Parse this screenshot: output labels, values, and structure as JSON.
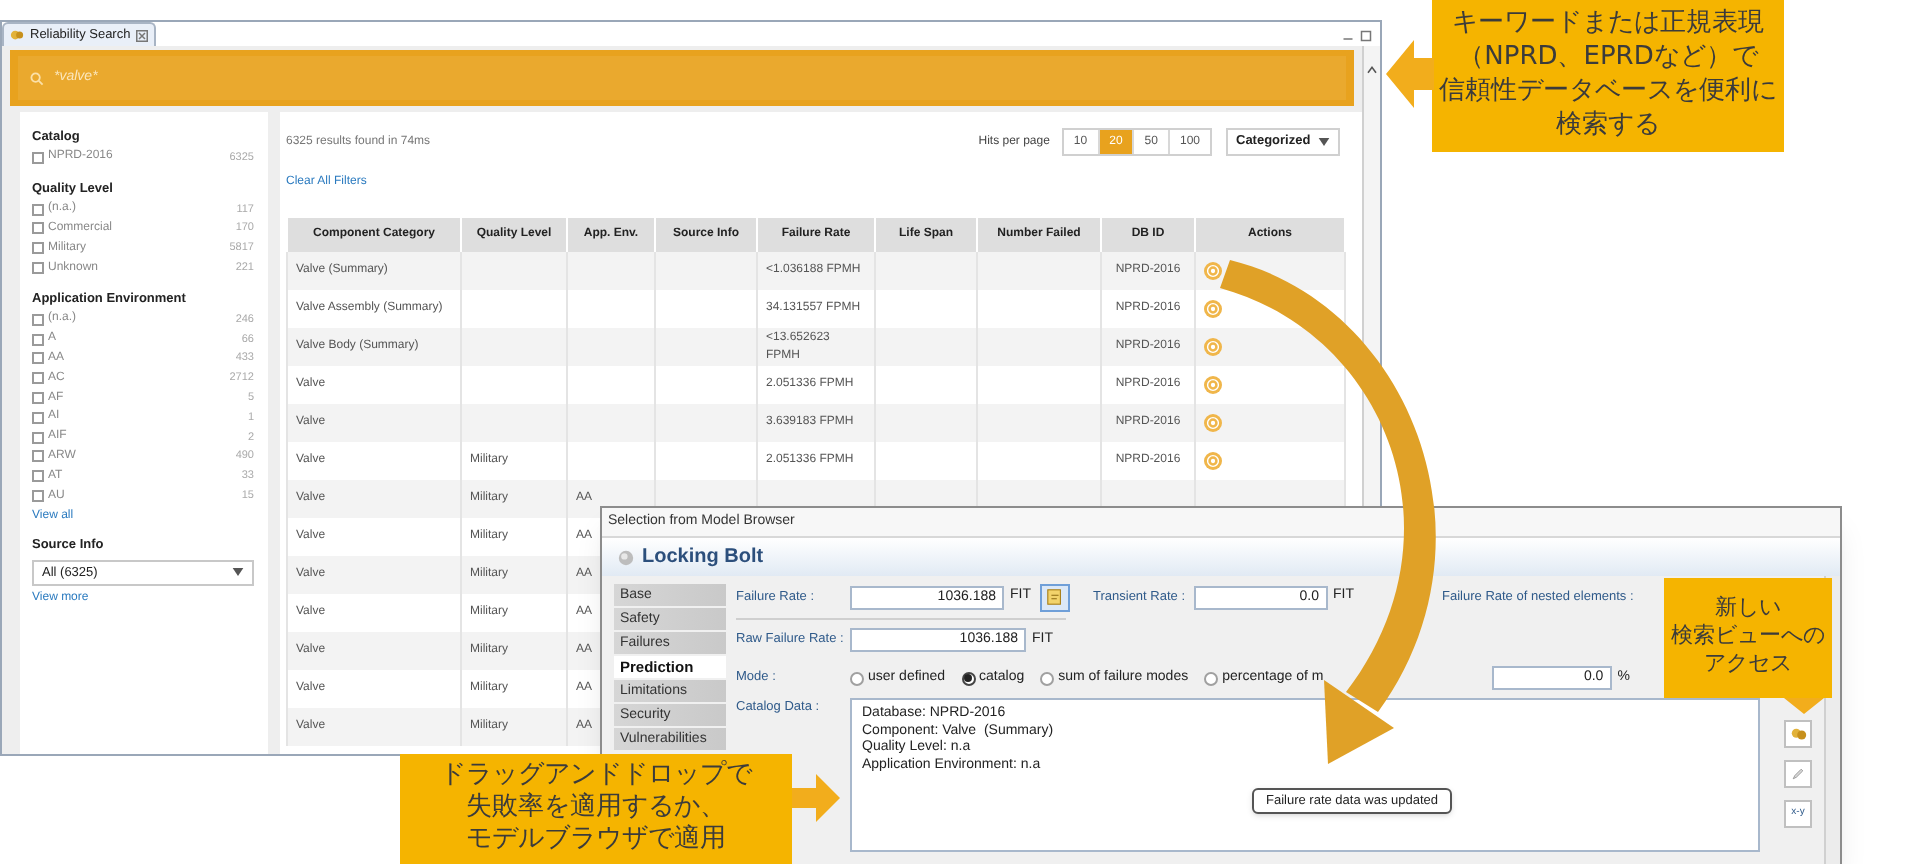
{
  "view_tab": {
    "title": "Reliability Search"
  },
  "search": {
    "value": "*valve*"
  },
  "filters": [
    {
      "title": "Catalog",
      "options": [
        {
          "label": "NPRD-2016",
          "count": "6325",
          "checked": false
        }
      ]
    },
    {
      "title": "Quality Level",
      "options": [
        {
          "label": "(n.a.)",
          "count": "117",
          "checked": false
        },
        {
          "label": "Commercial",
          "count": "170",
          "checked": false
        },
        {
          "label": "Military",
          "count": "5817",
          "checked": false
        },
        {
          "label": "Unknown",
          "count": "221",
          "checked": false
        }
      ]
    },
    {
      "title": "Application Environment",
      "link": "View all",
      "options": [
        {
          "label": "(n.a.)",
          "count": "246",
          "checked": false
        },
        {
          "label": "A",
          "count": "66",
          "checked": false
        },
        {
          "label": "AA",
          "count": "433",
          "checked": false
        },
        {
          "label": "AC",
          "count": "2712",
          "checked": false
        },
        {
          "label": "AF",
          "count": "5",
          "checked": false
        },
        {
          "label": "AI",
          "count": "1",
          "checked": false
        },
        {
          "label": "AIF",
          "count": "2",
          "checked": false
        },
        {
          "label": "ARW",
          "count": "490",
          "checked": false
        },
        {
          "label": "AT",
          "count": "33",
          "checked": false
        },
        {
          "label": "AU",
          "count": "15",
          "checked": false
        }
      ]
    }
  ],
  "source_info": {
    "title": "Source Info",
    "value": "All (6325)",
    "link": "View more"
  },
  "results": {
    "summary": "6325 results found in 74ms",
    "clear_link": "Clear All Filters",
    "hits_label": "Hits per page",
    "hits": [
      {
        "label": "10",
        "selected": false
      },
      {
        "label": "20",
        "selected": true
      },
      {
        "label": "50",
        "selected": false
      },
      {
        "label": "100",
        "selected": false
      }
    ],
    "view_mode": "Categorized"
  },
  "table": {
    "columns": [
      "Component Category",
      "Quality Level",
      "App. Env.",
      "Source Info",
      "Failure Rate",
      "Life Span",
      "Number Failed",
      "DB ID",
      "Actions"
    ],
    "rows": [
      {
        "category": "Valve (Summary)",
        "failure_rate": "<1.036188 FPMH",
        "db_id": "NPRD-2016",
        "action": true
      },
      {
        "category": "Valve Assembly (Summary)",
        "failure_rate": "34.131557 FPMH",
        "db_id": "NPRD-2016",
        "action": true
      },
      {
        "category": "Valve Body (Summary)",
        "failure_rate": "<13.652623 FPMH",
        "db_id": "NPRD-2016",
        "action": true
      },
      {
        "category": "Valve",
        "failure_rate": "2.051336 FPMH",
        "db_id": "NPRD-2016",
        "action": true
      },
      {
        "category": "Valve",
        "failure_rate": "3.639183 FPMH",
        "db_id": "NPRD-2016",
        "action": true
      },
      {
        "category": "Valve",
        "quality": "Military",
        "failure_rate": "2.051336 FPMH",
        "db_id": "NPRD-2016",
        "action": true
      },
      {
        "category": "Valve",
        "quality": "Military",
        "env": "AA"
      },
      {
        "category": "Valve",
        "quality": "Military",
        "env": "AA"
      },
      {
        "category": "Valve",
        "quality": "Military",
        "env": "AA"
      },
      {
        "category": "Valve",
        "quality": "Military",
        "env": "AA"
      },
      {
        "category": "Valve",
        "quality": "Military",
        "env": "AA"
      },
      {
        "category": "Valve",
        "quality": "Military",
        "env": "AA"
      },
      {
        "category": "Valve",
        "quality": "Military",
        "env": "AA"
      }
    ]
  },
  "dialog": {
    "title": "Selection from Model Browser",
    "header": "Locking Bolt",
    "tabs": [
      {
        "label": "Base",
        "selected": false
      },
      {
        "label": "Safety",
        "selected": false
      },
      {
        "label": "Failures",
        "selected": false
      },
      {
        "label": "Prediction",
        "selected": true
      },
      {
        "label": "Limitations",
        "selected": false
      },
      {
        "label": "Security",
        "selected": false
      },
      {
        "label": "Vulnerabilities",
        "selected": false
      }
    ],
    "failure_rate": {
      "label": "Failure Rate :",
      "value": "1036.188",
      "unit": "FIT"
    },
    "transient_rate": {
      "label": "Transient Rate :",
      "value": "0.0",
      "unit": "FIT"
    },
    "nested_label": "Failure Rate of nested elements :",
    "raw_failure_rate": {
      "label": "Raw Failure Rate :",
      "value": "1036.188",
      "unit": "FIT"
    },
    "mode": {
      "label": "Mode :",
      "options": [
        {
          "label": "user defined",
          "selected": false
        },
        {
          "label": "catalog",
          "selected": true
        },
        {
          "label": "sum of failure modes",
          "selected": false
        },
        {
          "label": "percentage of m",
          "selected": false
        }
      ],
      "percent_value": "0.0",
      "percent_unit": "%"
    },
    "catalog_data": {
      "label": "Catalog Data :",
      "lines": [
        "Database: NPRD-2016",
        "Component: Valve  (Summary)",
        "Quality Level: n.a",
        "Application Environment: n.a"
      ]
    },
    "tooltip": "Failure rate data was updated",
    "formula_button": "x-y"
  },
  "callouts": [
    {
      "lines": [
        "キーワードまたは正規表現",
        "（NPRD、EPRDなど）で",
        "信頼性データベースを便利に",
        "検索する"
      ]
    },
    {
      "lines": [
        "ドラッグアンドドロップで",
        "失敗率を適用するか、",
        "モデルブラウザで適用"
      ]
    },
    {
      "lines": [
        "新しい",
        "検索ビューへの",
        "アクセス"
      ]
    }
  ]
}
